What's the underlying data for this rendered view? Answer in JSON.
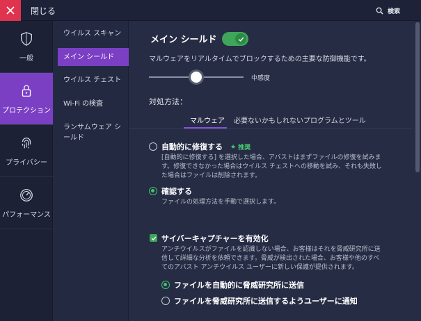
{
  "topbar": {
    "close_label": "閉じる",
    "search_label": "検索"
  },
  "leftnav": {
    "items": [
      {
        "label": "一般",
        "icon": "shield-icon"
      },
      {
        "label": "プロテクション",
        "icon": "lock-icon",
        "active": true
      },
      {
        "label": "プライバシー",
        "icon": "fingerprint-icon"
      },
      {
        "label": "パフォーマンス",
        "icon": "speedometer-icon"
      }
    ]
  },
  "subnav": {
    "items": [
      {
        "label": "ウイルス スキャン"
      },
      {
        "label": "メイン シールド",
        "active": true
      },
      {
        "label": "ウイルス チェスト"
      },
      {
        "label": "Wi-Fi の検査"
      },
      {
        "label": "ランサムウェア シールド"
      }
    ]
  },
  "main": {
    "title": "メイン シールド",
    "toggle_on": true,
    "description": "マルウェアをリアルタイムでブロックするための主要な防御機能です。",
    "sensitivity": {
      "label": "中感度",
      "value": 0.5
    },
    "handling_label": "対処方法：",
    "tabs": [
      {
        "label": "マルウェア",
        "active": true
      },
      {
        "label": "必要ないかもしれないプログラムとツール"
      }
    ],
    "options": [
      {
        "label": "自動的に修復する",
        "recommended": "推奨",
        "selected": false,
        "desc_lines": [
          "[自動的に修復する] を選択した場合、アバストはまずファイルの修復を試みま",
          "す。修復できなかった場合はウイルス チェストへの移動を試み、それも失敗し",
          "た場合はファイルは削除されます。"
        ]
      },
      {
        "label": "確認する",
        "selected": true,
        "desc_lines": [
          "ファイルの処理方法を手動で選択します。"
        ]
      }
    ],
    "cybercapture": {
      "label": "サイバーキャプチャーを有効化",
      "checked": true,
      "desc_lines": [
        "アンチウイルスがファイルを認識しない場合、お客様はそれを脅威研究所に送",
        "信して詳細な分析を依頼できます。脅威が検出された場合、お客様や他のすべ",
        "てのアバスト アンチウイルス ユーザーに新しい保護が提供されます。"
      ],
      "sub_options": [
        {
          "label": "ファイルを自動的に脅威研究所に送信",
          "selected": true
        },
        {
          "label": "ファイルを脅威研究所に送信するようユーザーに通知",
          "selected": false
        }
      ]
    }
  },
  "colors": {
    "accent": "#7b3fc4",
    "green": "#3ea55a",
    "close_red": "#e0334e",
    "bg": "#262c44"
  }
}
